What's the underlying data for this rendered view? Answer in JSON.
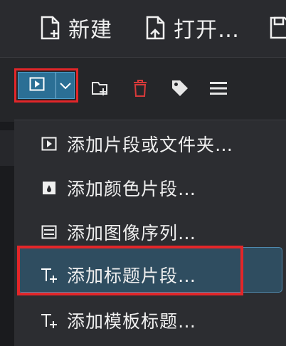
{
  "toolbar": {
    "new_label": "新建",
    "open_label": "打开…",
    "save_label": ""
  },
  "bin_toolbar": {
    "add_clip_icon": "clip-add-icon",
    "dropdown_icon": "chevron-down-icon",
    "folder_icon": "folder-add-icon",
    "delete_icon": "trash-icon",
    "tag_icon": "tag-icon",
    "menu_icon": "hamburger-menu-icon"
  },
  "menu": {
    "items": [
      {
        "label": "添加片段或文件夹…",
        "icon": "clip-add-icon"
      },
      {
        "label": "添加颜色片段…",
        "icon": "color-clip-icon"
      },
      {
        "label": "添加图像序列…",
        "icon": "image-sequence-icon"
      },
      {
        "label": "添加标题片段…",
        "icon": "title-clip-icon"
      },
      {
        "label": "添加模板标题…",
        "icon": "template-title-icon"
      }
    ],
    "highlighted_index": 3
  },
  "colors": {
    "accent": "#2b6f95",
    "highlight": "#e32629",
    "menu_bg": "#2c2d31",
    "delete_red": "#d83a3a"
  }
}
